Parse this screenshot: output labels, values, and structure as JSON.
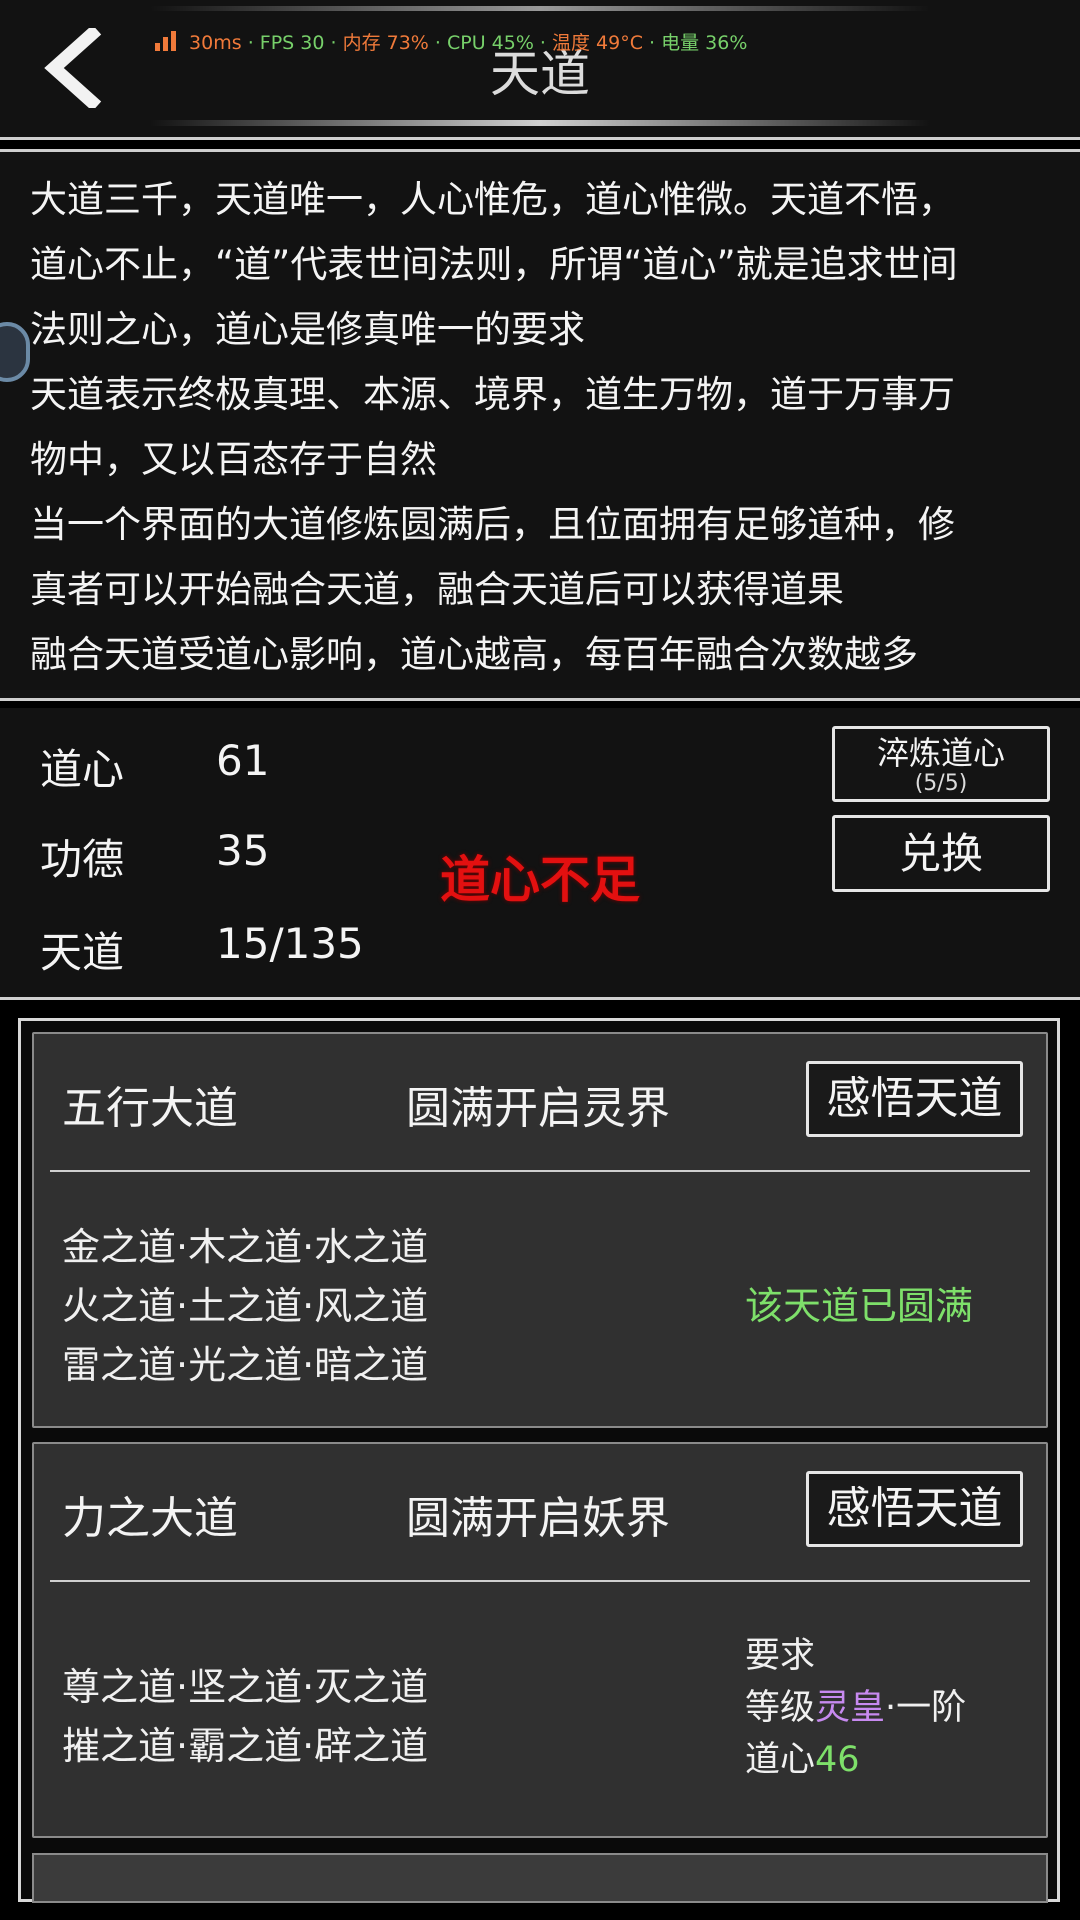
{
  "header": {
    "title": "天道",
    "back_icon": "chevron-left-icon",
    "perf": {
      "latency": "30ms",
      "fps": "· FPS 30 ·",
      "memory": "内存 73%",
      "cpu": "· CPU 45% ·",
      "temp": "温度 49°C",
      "battery": "· 电量 36%"
    }
  },
  "description": {
    "lines": [
      "大道三千，天道唯一，人心惟危，道心惟微。天道不悟，",
      "道心不止，“道”代表世间法则，所谓“道心”就是追求世间",
      "法则之心，道心是修真唯一的要求",
      "天道表示终极真理、本源、境界，道生万物，道于万事万",
      "物中，又以百态存于自然",
      "当一个界面的大道修炼圆满后，且位面拥有足够道种，修",
      "真者可以开始融合天道，融合天道后可以获得道果",
      "融合天道受道心影响，道心越高，每百年融合次数越多"
    ]
  },
  "stats": {
    "items": [
      {
        "label": "道心",
        "value": "61"
      },
      {
        "label": "功德",
        "value": "35"
      },
      {
        "label": "天道",
        "value": "15/135"
      }
    ],
    "warning": "道心不足",
    "refine_button": {
      "label": "淬炼道心",
      "count": "(5/5)"
    },
    "exchange_button": "兑换"
  },
  "paths": [
    {
      "name": "五行大道",
      "unlock": "圆满开启灵界",
      "button": "感悟天道",
      "lines": [
        "金之道·木之道·水之道",
        "火之道·土之道·风之道",
        "雷之道·光之道·暗之道"
      ],
      "status": "该天道已圆满"
    },
    {
      "name": "力之大道",
      "unlock": "圆满开启妖界",
      "button": "感悟天道",
      "lines": [
        "尊之道·坚之道·灭之道",
        "摧之道·霸之道·辟之道"
      ],
      "requirement": {
        "title": "要求",
        "level_prefix": "等级",
        "level_name": "灵皇",
        "level_suffix": "·一阶",
        "daoxin_prefix": "道心",
        "daoxin_value": "46"
      }
    }
  ],
  "colors": {
    "warning": "#e31010",
    "complete": "#7ee06a",
    "rank": "#c78af0",
    "perf_orange": "#f07a3a",
    "perf_green": "#77d06a"
  }
}
